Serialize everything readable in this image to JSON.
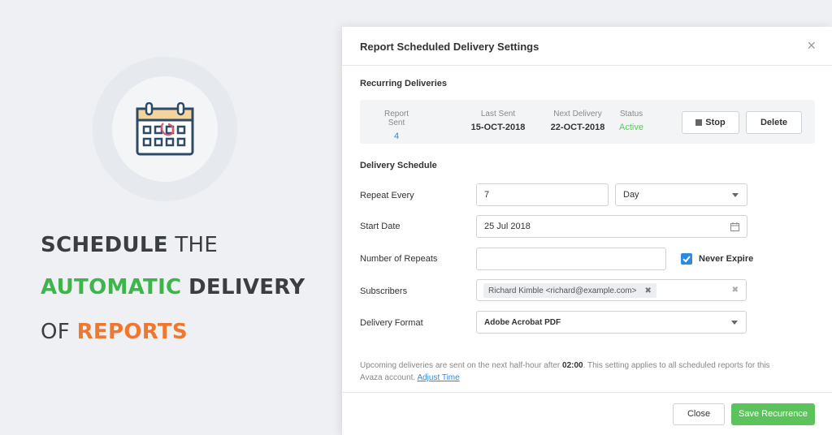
{
  "hero": {
    "line1_bold": "SCHEDULE",
    "line1_rest": "THE",
    "line2_green": "AUTOMATIC",
    "line2_bold": "DELIVERY",
    "line3_pre": "OF",
    "line3_orange": "REPORTS"
  },
  "modal": {
    "title": "Report Scheduled Delivery Settings",
    "close_glyph": "×",
    "recurring_title": "Recurring Deliveries",
    "stats": [
      {
        "label": "Report Sent",
        "value": "4"
      },
      {
        "label": "Last Sent",
        "value": "15-OCT-2018"
      },
      {
        "label": "Next Delivery",
        "value": "22-OCT-2018"
      },
      {
        "label": "Status",
        "value": "Active"
      }
    ],
    "stop_label": "Stop",
    "delete_label": "Delete",
    "schedule_title": "Delivery Schedule",
    "repeat_every_label": "Repeat Every",
    "repeat_every_value": "7",
    "repeat_unit": "Day",
    "start_date_label": "Start Date",
    "start_date_value": "25 Jul 2018",
    "repeats_label": "Number of Repeats",
    "repeats_value": "",
    "never_expire_label": "Never Expire",
    "subscribers_label": "Subscribers",
    "subscriber_tag": "Richard Kimble <richard@example.com>",
    "format_label": "Delivery Format",
    "format_value": "Adobe Acrobat PDF",
    "note_pre": "Upcoming deliveries are sent on the next half-hour after",
    "note_time": "02:00",
    "note_post": ". This setting applies to all scheduled reports for this Avaza account.",
    "adjust_time": "Adjust Time",
    "close_label": "Close",
    "save_label": "Save Recurrence"
  },
  "colors": {
    "accent_blue": "#2c8ae0",
    "active_green": "#5cc95c",
    "save_green": "#5cc35c",
    "hero_green": "#3db54a",
    "hero_orange": "#f0772f"
  }
}
